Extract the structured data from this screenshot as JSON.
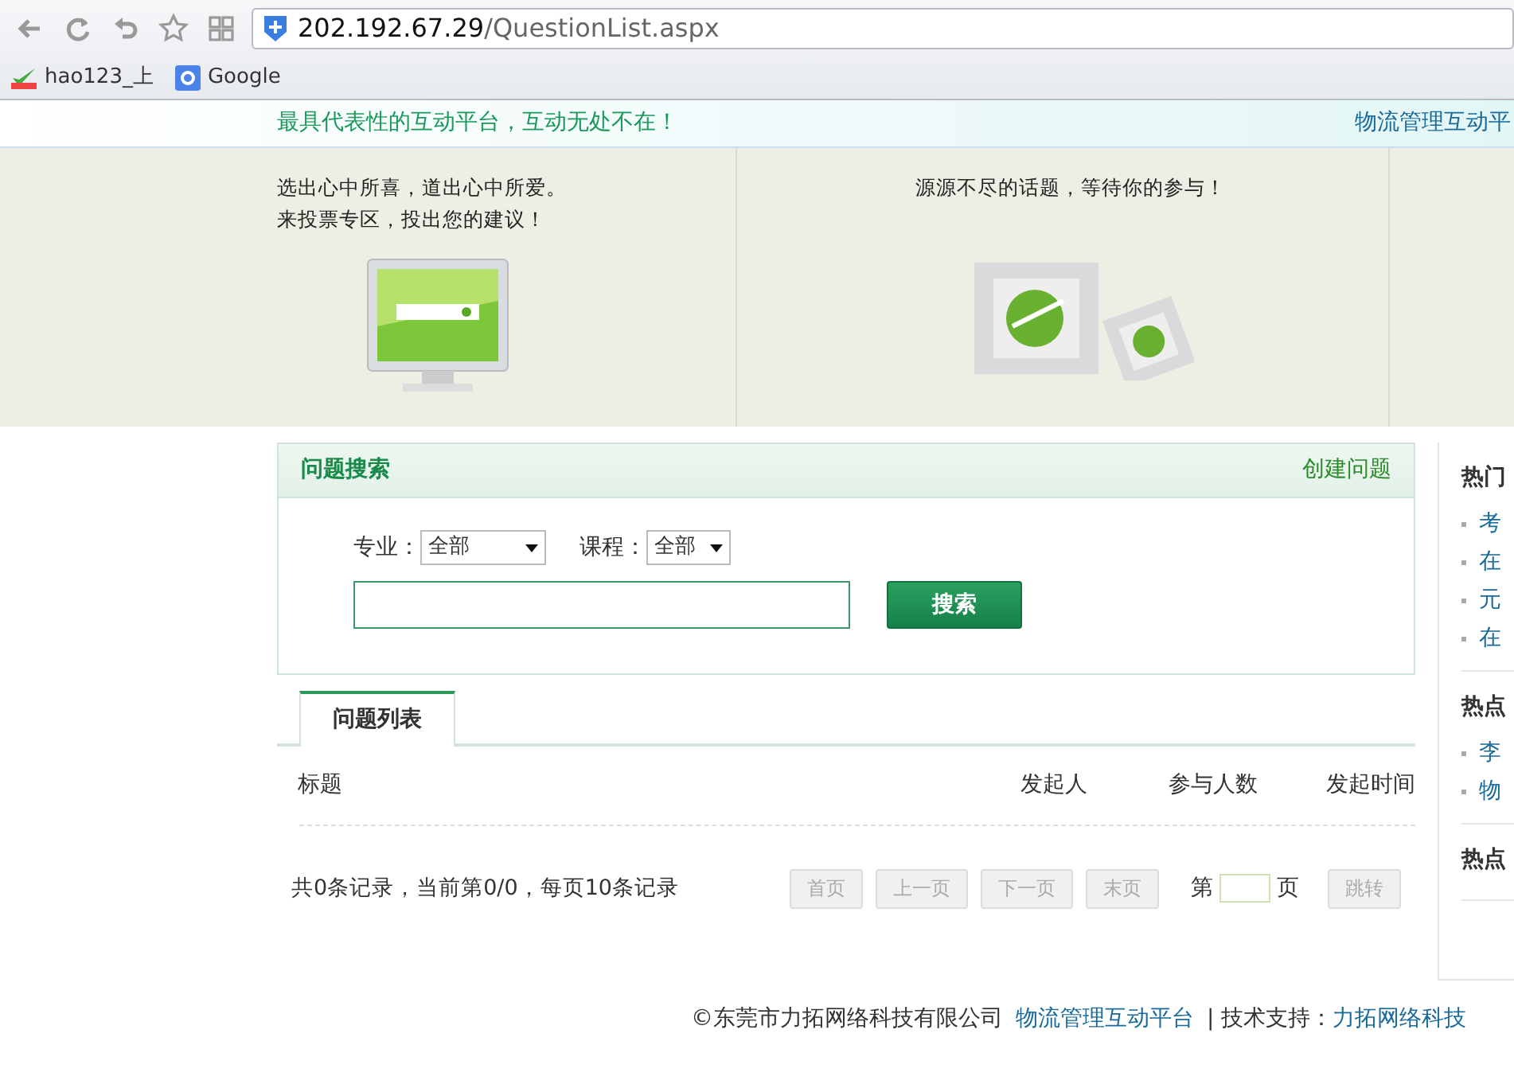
{
  "browser": {
    "url_host": "202.192.67.29",
    "url_path": "/QuestionList.aspx",
    "bookmarks": [
      {
        "label": "hao123_上"
      },
      {
        "label": "Google"
      }
    ]
  },
  "header": {
    "slogan": "最具代表性的互动平台，互动无处不在！",
    "site_name": "物流管理互动平"
  },
  "banner": [
    {
      "text": "选出心中所喜，道出心中所爱。来投票专区，投出您的建议！"
    },
    {
      "text": "源源不尽的话题，等待你的参与！"
    }
  ],
  "search_panel": {
    "title": "问题搜索",
    "create_link": "创建问题",
    "major_label": "专业：",
    "major_value": "全部",
    "course_label": "课程：",
    "course_value": "全部",
    "search_button": "搜索"
  },
  "tabs": [
    {
      "label": "问题列表",
      "selected": true
    }
  ],
  "table": {
    "columns": [
      "标题",
      "发起人",
      "参与人数",
      "发起时间"
    ]
  },
  "pager": {
    "summary": "共0条记录，当前第0/0，每页10条记录",
    "buttons": [
      "首页",
      "上一页",
      "下一页",
      "末页"
    ],
    "page_prefix": "第",
    "page_suffix": "页",
    "jump": "跳转"
  },
  "sidebar": [
    {
      "title": "热门",
      "items": [
        "考",
        "在",
        "元",
        "在"
      ]
    },
    {
      "title": "热点",
      "items": [
        "李",
        "物"
      ]
    },
    {
      "title": "热点"
    }
  ],
  "footer": {
    "copyright": "©东莞市力拓网络科技有限公司",
    "site_link": "物流管理互动平台",
    "support": "| 技术支持：",
    "support_link": "力拓网络科技"
  }
}
